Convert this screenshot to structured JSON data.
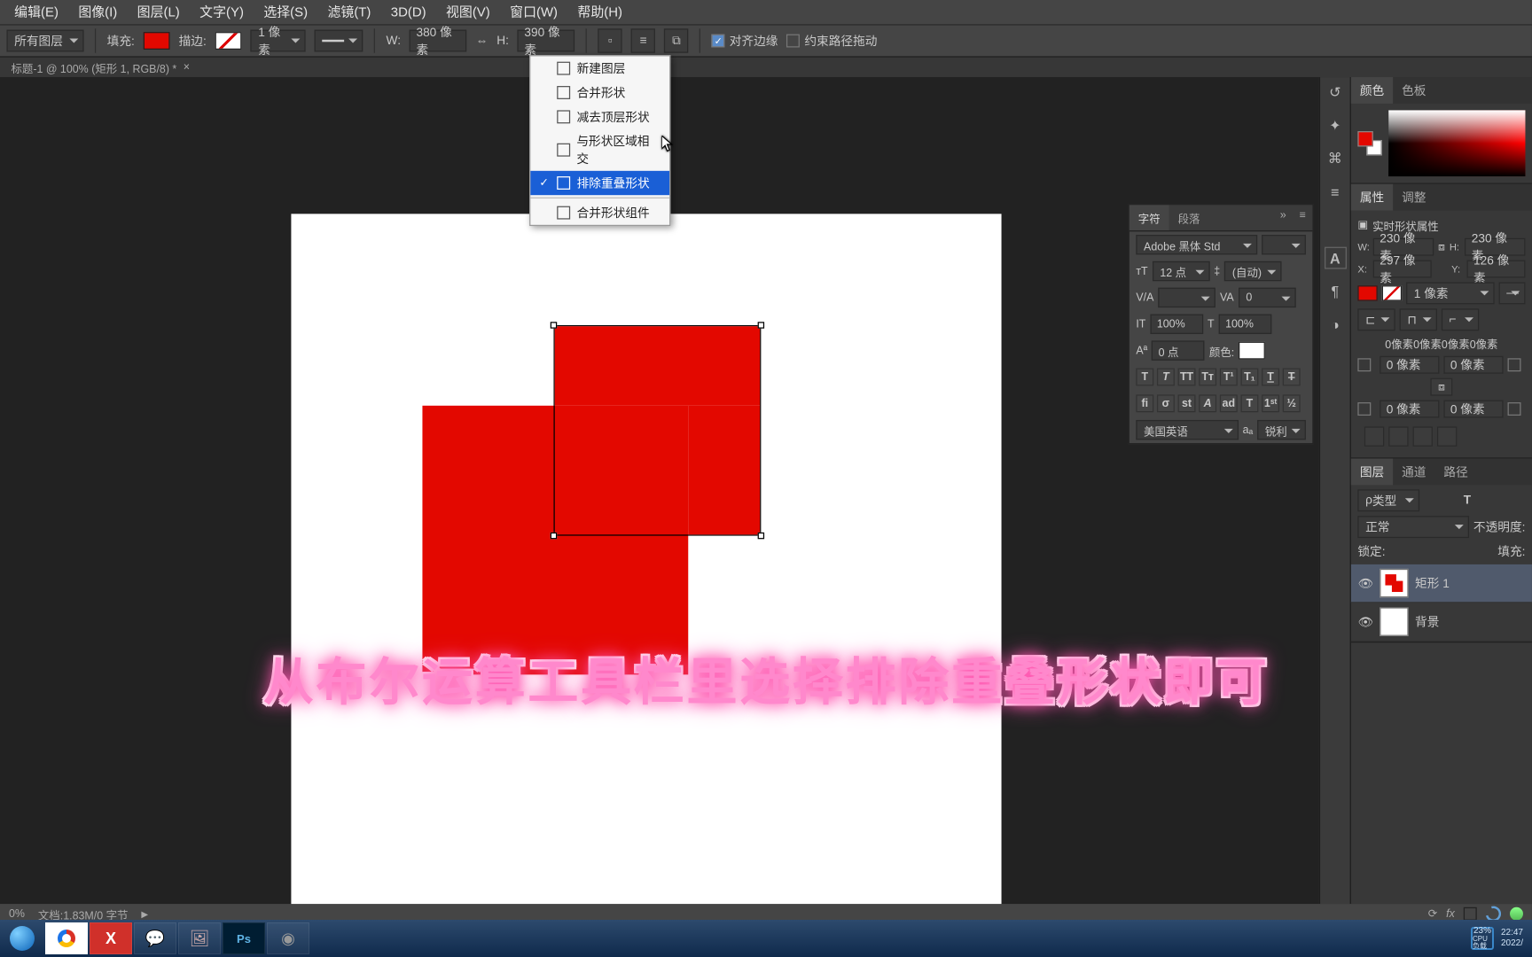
{
  "menubar": [
    "编辑(E)",
    "图像(I)",
    "图层(L)",
    "文字(Y)",
    "选择(S)",
    "滤镜(T)",
    "3D(D)",
    "视图(V)",
    "窗口(W)",
    "帮助(H)"
  ],
  "optbar": {
    "layer_target": "所有图层",
    "fill_label": "填充:",
    "fill_color": "#e30800",
    "stroke_label": "描边:",
    "stroke_color": "#ffffff",
    "stroke_size": "1 像素",
    "w_label": "W:",
    "w_val": "380 像素",
    "h_label": "H:",
    "h_val": "390 像素",
    "align_edges": "对齐边缘",
    "constrain": "约束路径拖动"
  },
  "doc_tab": "标题-1 @ 100% (矩形 1, RGB/8) *",
  "path_menu": {
    "items": [
      "新建图层",
      "合并形状",
      "减去顶层形状",
      "与形状区域相交",
      "排除重叠形状"
    ],
    "selected_index": 4,
    "footer": "合并形状组件"
  },
  "caption": "从布尔运算工具栏里选择排除重叠形状即可",
  "char_panel": {
    "tab1": "字符",
    "tab2": "段落",
    "font": "Adobe 黑体 Std",
    "size": "12 点",
    "leading": "(自动)",
    "tracking": "0",
    "vscale": "100%",
    "hscale": "100%",
    "baseline": "0 点",
    "color_label": "颜色:",
    "color": "#ffffff",
    "lang": "美国英语",
    "aa": "锐利"
  },
  "dock_right": {
    "color_tab": "颜色",
    "swatch_tab": "色板",
    "props_tab": "属性",
    "adjust_tab": "调整",
    "props_title": "实时形状属性",
    "W": "230 像素",
    "H": "230 像素",
    "X": "297 像素",
    "Y": "126 像素",
    "stroke_val": "1 像素",
    "corner": "0 像素",
    "corner_row_top": "0像素0像素0像素0像素",
    "zero_px": "0 像素",
    "layers_tab": "图层",
    "channels_tab": "通道",
    "paths_tab": "路径",
    "kind_label": "类型",
    "blend": "正常",
    "opacity_label": "不透明度:",
    "lock_label": "锁定:",
    "fill_label": "填充:",
    "layer1": "矩形 1",
    "layer_bg": "背景"
  },
  "statusbar": {
    "zoom": "0%",
    "docinfo": "文档:1.83M/0 字节"
  },
  "taskbar": {
    "cpu_pct": "23%",
    "cpu_label": "CPU负载",
    "time": "22:47",
    "date": "2022/"
  }
}
